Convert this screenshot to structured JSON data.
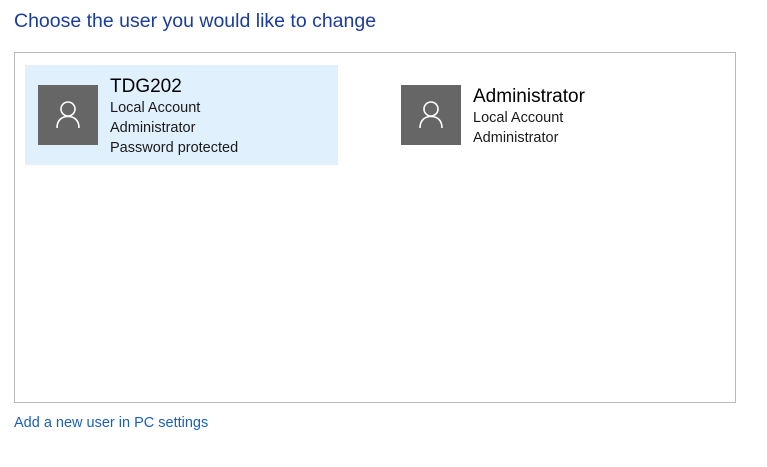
{
  "page": {
    "title": "Choose the user you would like to change"
  },
  "accounts": [
    {
      "name": "TDG202",
      "type": "Local Account",
      "role": "Administrator",
      "status": "Password protected",
      "selected": true,
      "icon": "user-icon"
    },
    {
      "name": "Administrator",
      "type": "Local Account",
      "role": "Administrator",
      "selected": false,
      "icon": "user-icon"
    }
  ],
  "links": {
    "add_user": "Add a new user in PC settings"
  },
  "colors": {
    "title": "#1a3c9c",
    "link": "#1d5fb8",
    "selected_tile": "#e1f0fd",
    "avatar_bg": "#666666",
    "panel_border": "#b9b9b9"
  }
}
